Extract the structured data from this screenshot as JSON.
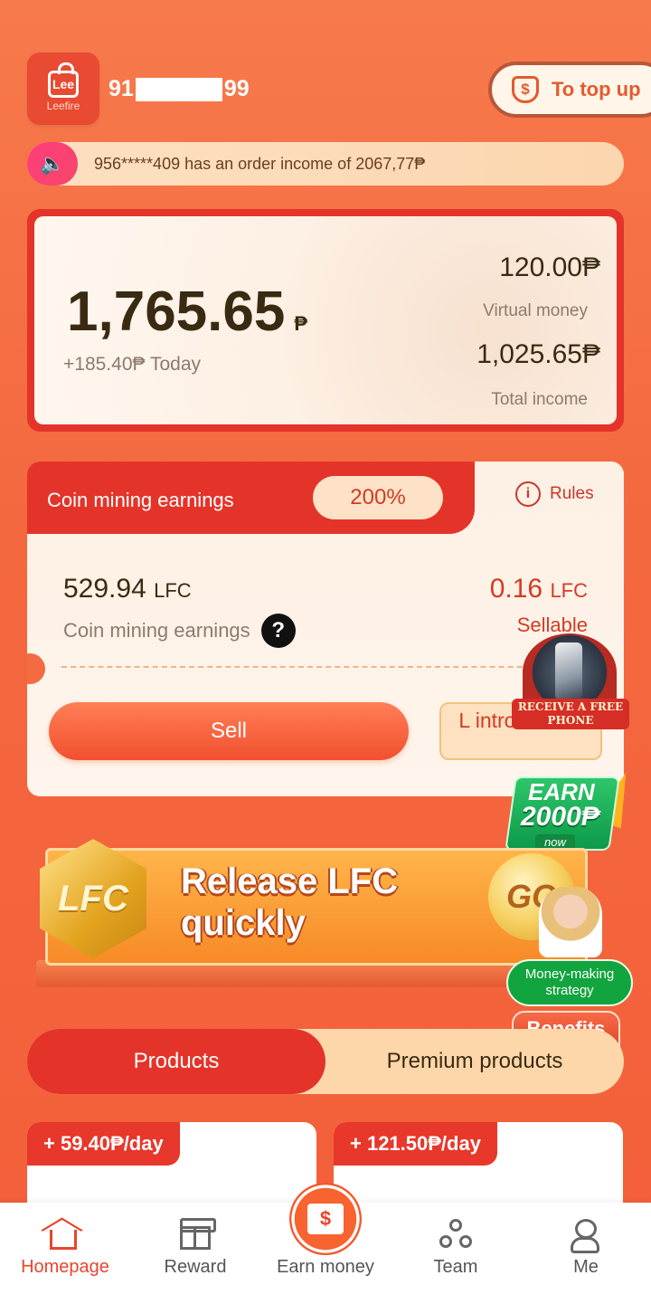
{
  "header": {
    "logo_text": "Lee",
    "logo_sub": "Leefire",
    "phone_prefix": "91",
    "phone_suffix": "99",
    "topup_label": "To top up"
  },
  "notice": {
    "text": "956*****409 has an order income of 2067,77₱"
  },
  "balance": {
    "amount": "1,765.65",
    "currency": "₱",
    "today": "+185.40₱ Today",
    "virtual_amount": "120.00₱",
    "virtual_label": "Virtual money",
    "total_amount": "1,025.65₱",
    "total_label": "Total income"
  },
  "mining": {
    "title": "Coin mining earnings",
    "percent": "200%",
    "rules_label": "Rules",
    "earn_value": "529.94",
    "earn_unit": "LFC",
    "earn_label": "Coin mining earnings",
    "sellable_value": "0.16",
    "sellable_unit": "LFC",
    "sellable_label": "Sellable",
    "sell_button": "Sell",
    "intro_button": "L introduction"
  },
  "promo": {
    "phone_badge": "RECEIVE A FREE PHONE",
    "earn_line1": "EARN",
    "earn_line2": "2000₱",
    "earn_now": "now",
    "banner_coin": "LFC",
    "banner_title": "Release LFC\nquickly",
    "banner_go": "GO",
    "strategy": "Money-making strategy",
    "benefits": "Benefits"
  },
  "tabs": {
    "products": "Products",
    "premium": "Premium products"
  },
  "products": [
    {
      "tag": "+ 59.40₱/day"
    },
    {
      "tag": "+ 121.50₱/day"
    }
  ],
  "nav": {
    "home": "Homepage",
    "reward": "Reward",
    "earn": "Earn money",
    "team": "Team",
    "me": "Me",
    "active_color": "#e8452e"
  }
}
